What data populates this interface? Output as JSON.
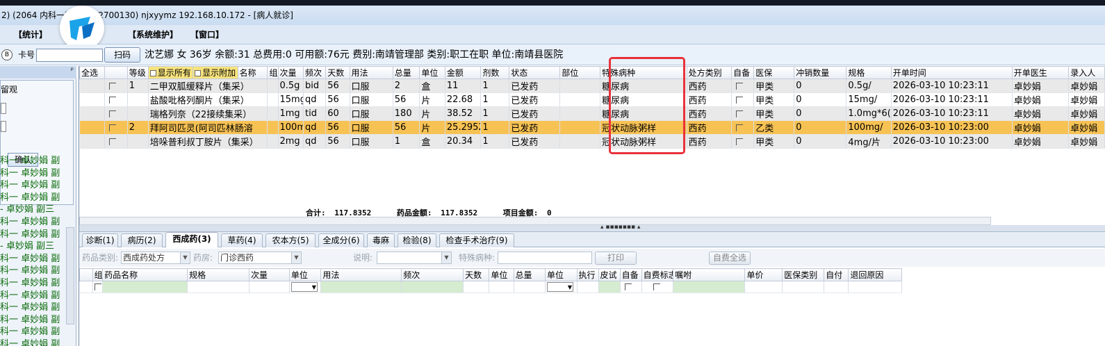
{
  "window": {
    "title": "2) (2064 内科一)          H35062700130) njxyymz 192.168.10.172 - [病人就诊]"
  },
  "menu": {
    "items": [
      "【统计】",
      "【系统维护】",
      "【窗口】"
    ]
  },
  "infobar": {
    "circle_label": "B",
    "card_label": "卡号",
    "scan_button": "扫码",
    "patient_line": "沈艺娜 女 36岁 余额:31 总费用:0 可用额:76元 费别:南靖管理部 类别:职工在职 单位:南靖县医院"
  },
  "left_panel": {
    "pin": "ᵖ",
    "title_fragment": "留观",
    "confirm_button": "确认",
    "list": [
      "科一 卓妙娟 副",
      "科一 卓妙娟 副",
      "科一 卓妙娟 副",
      "科一 卓妙娟 副",
      "- 卓妙娟 副三",
      "科一 卓妙娟 副",
      "科一 卓妙娟 副",
      "- 卓妙娟 副三",
      "科一 卓妙娟 副",
      "科一 卓妙娟 副",
      "科一 卓妙娟 副",
      "科一 卓妙娟 副",
      "科一 卓妙娟 副",
      "科一 卓妙娟 副",
      "科一 卓妙娟 副",
      "科一 卓妙娟 副"
    ]
  },
  "rx_grid": {
    "headers": [
      "全选",
      "等级",
      "显示所有",
      "显示附加",
      "名称",
      "组",
      "次量",
      "频次",
      "天数",
      "用法",
      "总量",
      "单位",
      "金额",
      "剂数",
      "状态",
      "部位",
      "特殊病种",
      "处方类别",
      "自备",
      "医保",
      "冲销数量",
      "规格",
      "开单时间",
      "开单医生",
      "录入人"
    ],
    "rows": [
      {
        "grade": "1",
        "name": "二甲双胍缓释片（集采）",
        "dose": "0.5g",
        "freq": "bid",
        "days": "56",
        "usage": "口服",
        "total": "2",
        "unit": "盒",
        "amount": "11",
        "count": "1",
        "status": "已发药",
        "part": "",
        "disease": "糖尿病",
        "rx_type": "西药",
        "ins": "甲类",
        "cancel": "0",
        "spec": "0.5g/",
        "time": "2026-03-10 10:23:11",
        "doctor": "卓妙娟",
        "entry": "卓妙娟"
      },
      {
        "grade": "",
        "name": "盐酸吡格列酮片（集采）",
        "dose": "15mg",
        "freq": "qd",
        "days": "56",
        "usage": "口服",
        "total": "56",
        "unit": "片",
        "amount": "22.68",
        "count": "1",
        "status": "已发药",
        "part": "",
        "disease": "糖尿病",
        "rx_type": "西药",
        "ins": "甲类",
        "cancel": "0",
        "spec": "15mg/",
        "time": "2026-03-10 10:23:11",
        "doctor": "卓妙娟",
        "entry": "卓妙娟"
      },
      {
        "grade": "",
        "name": "瑞格列奈（22接续集采）",
        "dose": "1mg",
        "freq": "tid",
        "days": "60",
        "usage": "口服",
        "total": "180",
        "unit": "片",
        "amount": "38.52",
        "count": "1",
        "status": "已发药",
        "part": "",
        "disease": "糖尿病",
        "rx_type": "西药",
        "ins": "甲类",
        "cancel": "0",
        "spec": "1.0mg*6(",
        "time": "2026-03-10 10:23:11",
        "doctor": "卓妙娟",
        "entry": "卓妙娟"
      },
      {
        "grade": "2",
        "name": "拜阿司匹灵(阿司匹林肠溶",
        "dose": "100m",
        "freq": "qd",
        "days": "56",
        "usage": "口服",
        "total": "56",
        "unit": "片",
        "amount": "25.2952",
        "count": "1",
        "status": "已发药",
        "part": "",
        "disease": "冠状动脉粥样",
        "rx_type": "西药",
        "ins": "乙类",
        "cancel": "0",
        "spec": "100mg/",
        "time": "2026-03-10 10:23:00",
        "doctor": "卓妙娟",
        "entry": "卓妙娟"
      },
      {
        "grade": "",
        "name": "培哚普利叔丁胺片（集采）",
        "dose": "2mg",
        "freq": "qd",
        "days": "56",
        "usage": "口服",
        "total": "1",
        "unit": "盒",
        "amount": "20.34",
        "count": "1",
        "status": "已发药",
        "part": "",
        "disease": "冠状动脉粥样",
        "rx_type": "西药",
        "ins": "甲类",
        "cancel": "0",
        "spec": "4mg/片",
        "time": "2026-03-10 10:23:00",
        "doctor": "卓妙娟",
        "entry": "卓妙娟"
      }
    ]
  },
  "totals": {
    "total_label": "合计:",
    "total_value": "117.8352",
    "drug_label": "药品金额:",
    "drug_value": "117.8352",
    "item_label": "项目金额:",
    "item_value": "0"
  },
  "splitter": {
    "grip": "▴ ▪▪▪▪▪▪▪ ▴"
  },
  "tabs": [
    "诊断(1)",
    "病历(2)",
    "西成药(3)",
    "草药(4)",
    "农本方(5)",
    "全成分(6)",
    "毒麻",
    "检验(8)",
    "检查手术治疗(9)"
  ],
  "active_tab": "西成药(3)",
  "filters": {
    "drug_type_label": "药品类别:",
    "drug_type_value": "西成药处方",
    "pharmacy_label": "药房:",
    "pharmacy_value": "门诊西药",
    "note_label": "说明:",
    "special_label": "特殊病种:",
    "print_button": "打印",
    "self_pay_button": "自费全选"
  },
  "entry_grid": {
    "headers": [
      "组",
      "药品名称",
      "规格",
      "次量",
      "单位",
      "用法",
      "频次",
      "天数",
      "单位",
      "总量",
      "单位",
      "执行",
      "皮试",
      "自备",
      "自费标志",
      "嘱咐",
      "单价",
      "医保类别",
      "自付",
      "退回原因"
    ]
  },
  "colors": {
    "selected_row": "#f7c254",
    "highlight_box": "#e8323a",
    "list_text": "#0a6b0a"
  }
}
